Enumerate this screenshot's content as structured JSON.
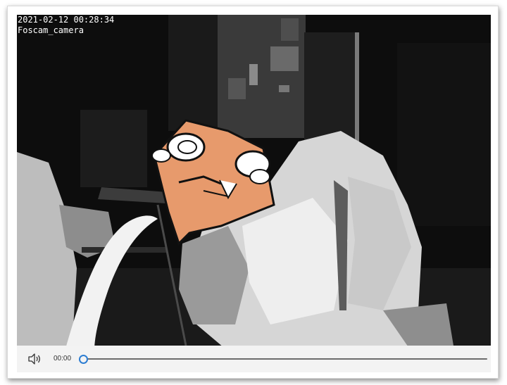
{
  "video": {
    "timestamp": "2021-02-12 00:28:34",
    "camera_name": "Foscam_camera"
  },
  "controls": {
    "current_time": "00:00",
    "progress": 0,
    "volume_icon": "speaker-icon"
  },
  "colors": {
    "accent": "#2c7dd2",
    "control_bar": "#f3f3f3",
    "video_bg": "#0c0c0c"
  }
}
